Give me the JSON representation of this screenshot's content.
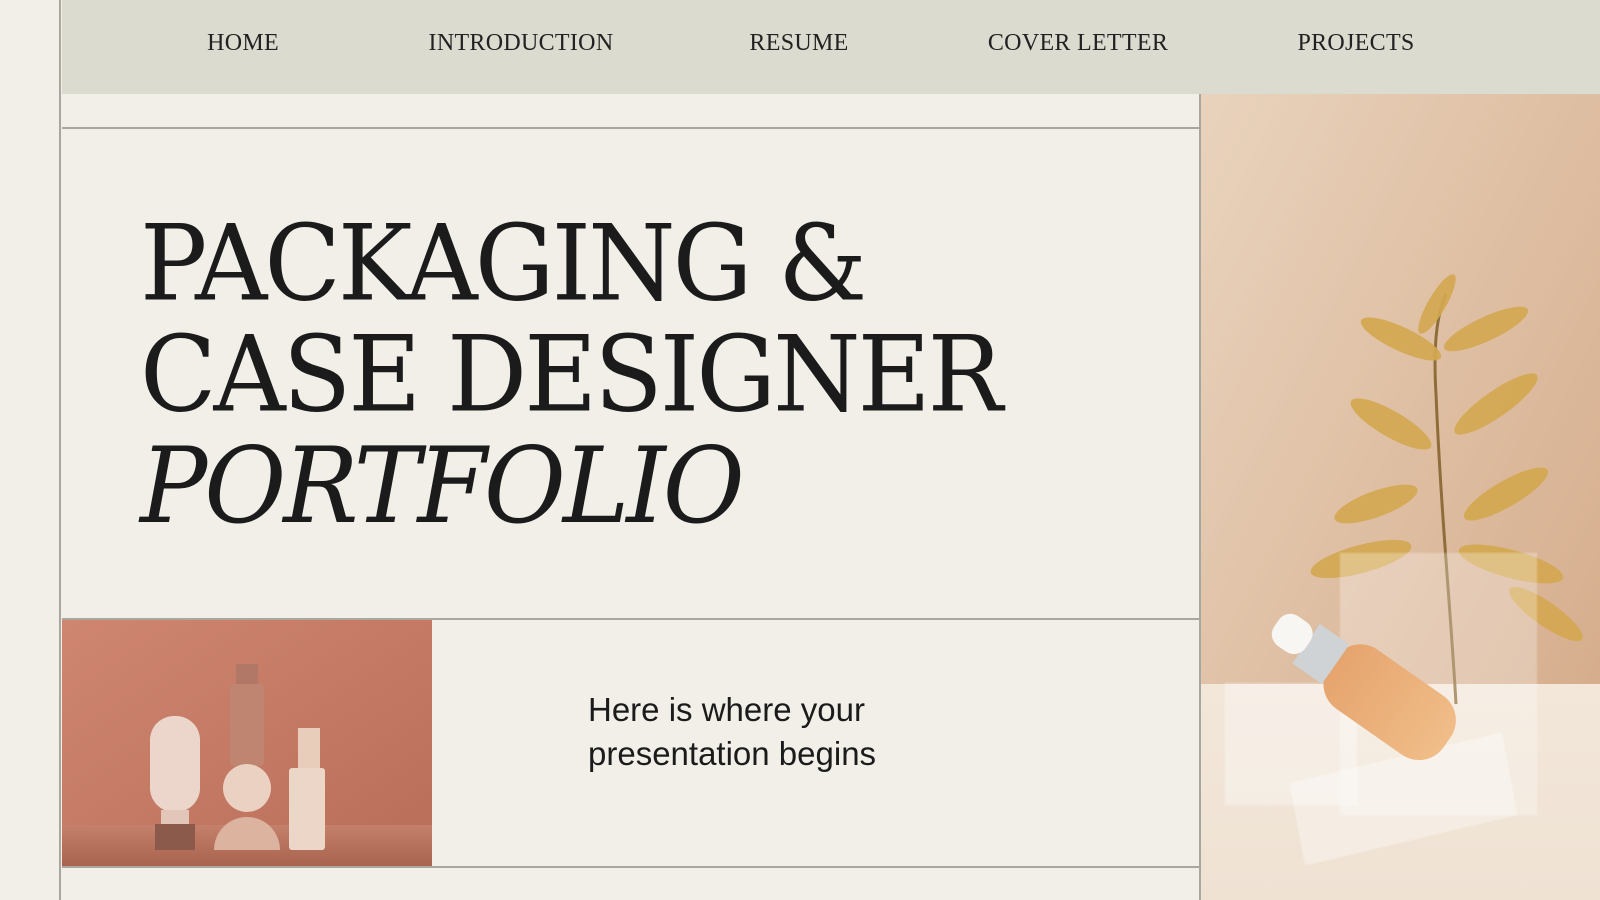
{
  "nav": {
    "items": [
      "HOME",
      "INTRODUCTION",
      "RESUME",
      "COVER LETTER",
      "PROJECTS"
    ]
  },
  "title": {
    "line1": "PACKAGING &",
    "line2": "CASE DESIGNER",
    "line3": "PORTFOLIO"
  },
  "subtitle": {
    "line1": "Here is where your",
    "line2": "presentation begins"
  },
  "colors": {
    "background": "#f1efe8",
    "navbar": "#dcdbd0",
    "rule": "#a8a69f",
    "text": "#1b1b1b",
    "terracotta": "#c98069",
    "peach": "#e8cdb2"
  },
  "images": {
    "bottom_left": "terracotta-bottles-photo",
    "right": "serum-dropper-plant-photo"
  }
}
